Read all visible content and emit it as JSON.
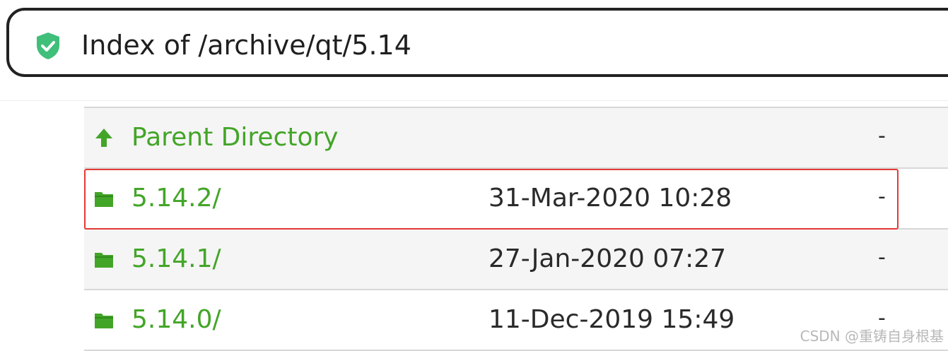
{
  "address_bar": {
    "url_text": "Index of /archive/qt/5.14",
    "security_icon": "shield-check-icon",
    "security_color": "#3fbf7a"
  },
  "listing": {
    "link_color": "#43a528",
    "rows": [
      {
        "name": "Parent Directory",
        "date": "",
        "size": "-",
        "icon": "up-arrow-icon"
      },
      {
        "name": "5.14.2/",
        "date": "31-Mar-2020 10:28",
        "size": "-",
        "icon": "folder-icon",
        "highlighted": true
      },
      {
        "name": "5.14.1/",
        "date": "27-Jan-2020 07:27",
        "size": "-",
        "icon": "folder-icon"
      },
      {
        "name": "5.14.0/",
        "date": "11-Dec-2019 15:49",
        "size": "-",
        "icon": "folder-icon"
      }
    ]
  },
  "highlight_color": "#e53935",
  "watermark": "CSDN @重铸自身根基"
}
